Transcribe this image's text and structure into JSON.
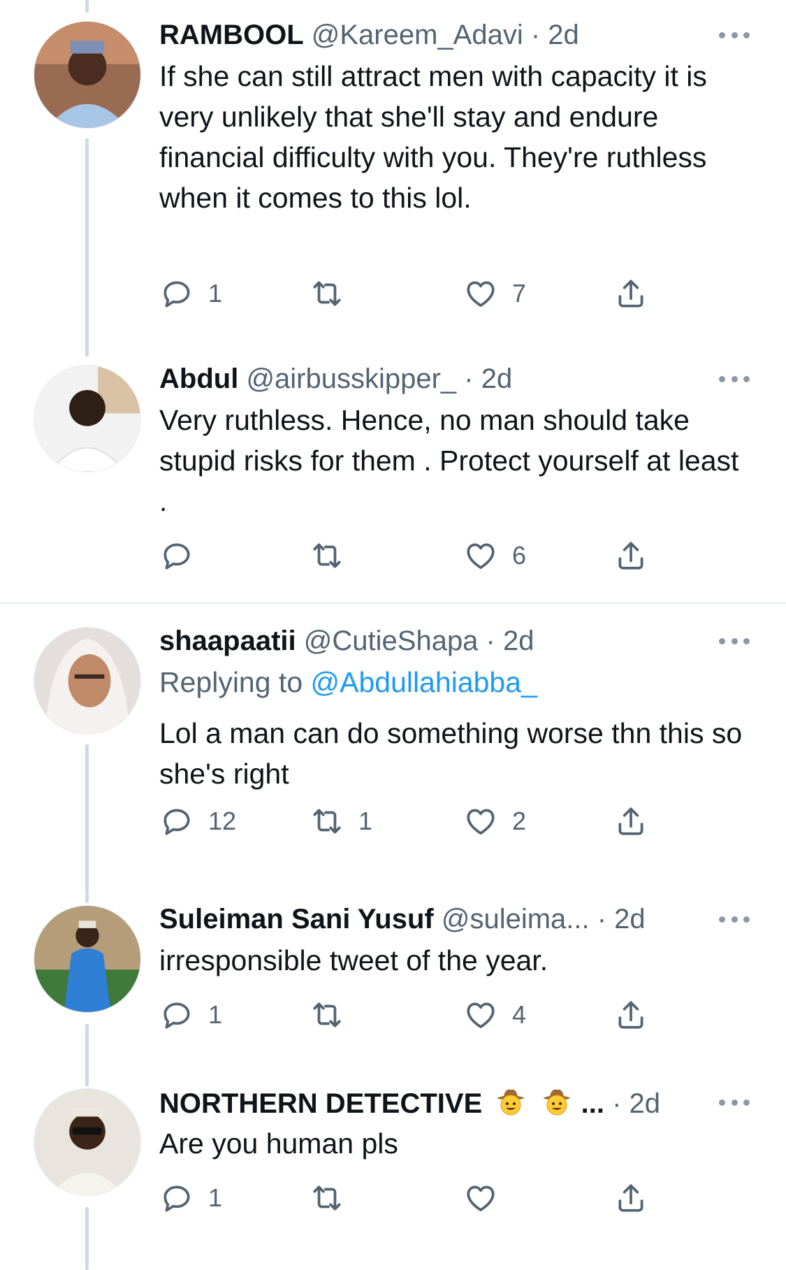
{
  "tweets": [
    {
      "name": "RAMBOOL",
      "handle": "@Kareem_Adavi",
      "sep": " · ",
      "time": "2d",
      "text": "If she can still attract men with capacity it is very unlikely that she'll stay and endure financial difficulty with you. They're ruthless when it comes to this lol.",
      "replies": "1",
      "retweets": "",
      "likes": "7"
    },
    {
      "name": "Abdul",
      "handle": "@airbusskipper_",
      "sep": " · ",
      "time": "2d",
      "text": "Very ruthless. Hence, no man should take stupid risks for them . Protect yourself at least .",
      "replies": "",
      "retweets": "",
      "likes": "6"
    },
    {
      "name": "shaapaatii",
      "handle": "@CutieShapa",
      "sep": " · ",
      "time": "2d",
      "replying_prefix": "Replying to ",
      "replying_to": "@Abdullahiabba_",
      "text": "Lol a man can do something worse thn this so she's right",
      "replies": "12",
      "retweets": "1",
      "likes": "2"
    },
    {
      "name": "Suleiman Sani Yusuf",
      "handle": "@suleima...",
      "sep": " · ",
      "time": "2d",
      "text": "irresponsible tweet of the year.",
      "replies": "1",
      "retweets": "",
      "likes": "4"
    },
    {
      "name": "NORTHERN DETECTIVE",
      "handle": "...",
      "sep": " · ",
      "time": "2d",
      "text": "Are you human pls",
      "replies": "1",
      "retweets": "",
      "likes": ""
    }
  ],
  "icons": {
    "reply": "reply-icon",
    "retweet": "retweet-icon",
    "like": "heart-icon",
    "share": "share-icon",
    "more": "more-options-icon",
    "emoji": "cowboy-face-emoji"
  },
  "colors": {
    "accent": "#1d9bf0",
    "secondary_text": "#536471",
    "thread_line": "#cfd9de"
  }
}
